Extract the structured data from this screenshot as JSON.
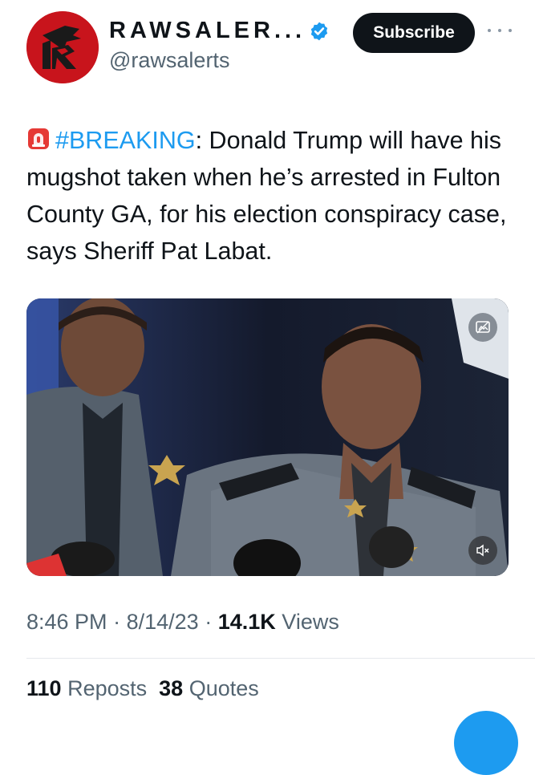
{
  "header": {
    "display_name": "RAWSALER...",
    "handle": "@rawsalerts",
    "subscribe_label": "Subscribe"
  },
  "tweet": {
    "hashtag": "#BREAKING",
    "text_after_hashtag": ": Donald Trump will have his mugshot taken when he’s arrested in Fulton County GA, for his election conspiracy case, says Sheriff Pat Labat."
  },
  "media": {
    "type": "video",
    "icons": [
      "alt-text-icon",
      "mute-icon"
    ]
  },
  "meta": {
    "time": "8:46 PM",
    "separator": "·",
    "date": "8/14/23",
    "views_count": "14.1K",
    "views_label": "Views"
  },
  "stats": {
    "reposts_count": "110",
    "reposts_label": "Reposts",
    "quotes_count": "38",
    "quotes_label": "Quotes"
  },
  "colors": {
    "accent": "#1d9bf0",
    "text": "#0f1419",
    "secondary": "#536471",
    "subscribe_bg": "#0f1419",
    "avatar_bg": "#c8141c"
  }
}
